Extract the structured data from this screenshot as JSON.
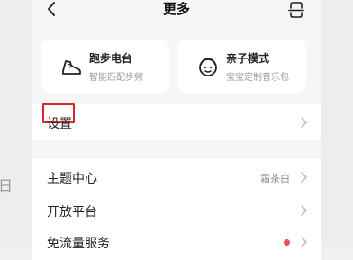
{
  "header": {
    "title": "更多",
    "back_icon": "chevron-left-icon",
    "scan_icon": "scan-icon"
  },
  "cards": [
    {
      "title": "跑步电台",
      "subtitle": "智能匹配步频",
      "icon": "running-shoe-icon"
    },
    {
      "title": "亲子模式",
      "subtitle": "宝宝定制音乐包",
      "icon": "child-face-icon"
    }
  ],
  "settings": {
    "label": "设置"
  },
  "theme": {
    "label": "主题中心",
    "value": "霜茶白"
  },
  "open_platform": {
    "label": "开放平台"
  },
  "free_data": {
    "label": "免流量服务"
  },
  "left_edge": {
    "glyph": "日"
  },
  "colors": {
    "highlight_border": "#d6282b",
    "notification_dot": "#ea4f5a",
    "page_bg": "#f6f6f6"
  }
}
